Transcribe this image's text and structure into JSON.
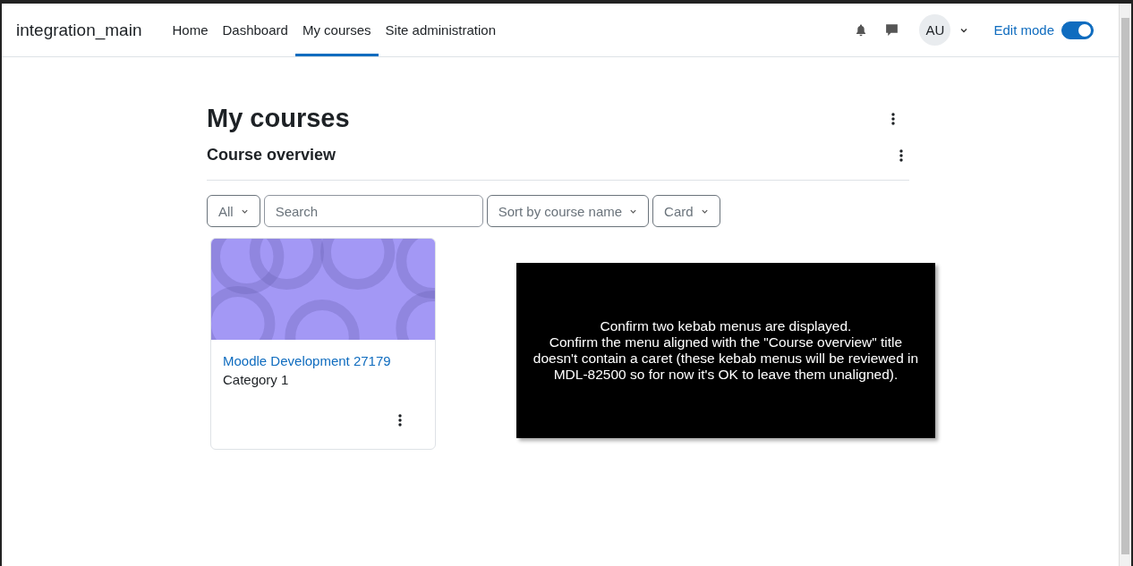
{
  "navbar": {
    "site_name": "integration_main",
    "links": [
      {
        "label": "Home",
        "selected": false
      },
      {
        "label": "Dashboard",
        "selected": false
      },
      {
        "label": "My courses",
        "selected": true
      },
      {
        "label": "Site administration",
        "selected": false
      }
    ],
    "avatar": "AU",
    "edit_mode": {
      "label": "Edit mode",
      "on": true
    }
  },
  "page": {
    "title": "My courses",
    "block_title": "Course overview",
    "filters": {
      "grouping": "All",
      "search": {
        "placeholder": "Search"
      },
      "sort": "Sort by course name",
      "view": "Card"
    },
    "courses": [
      {
        "name": "Moodle Development 27179",
        "category": "Category 1"
      }
    ]
  },
  "instructions": {
    "lines": [
      "Confirm two kebab menus are displayed.",
      "Confirm the menu aligned with the \"Course overview\" title",
      "doesn't contain a caret (these kebab menus will be reviewed in",
      "MDL-82500 so for now it's OK to leave them unaligned)."
    ]
  }
}
